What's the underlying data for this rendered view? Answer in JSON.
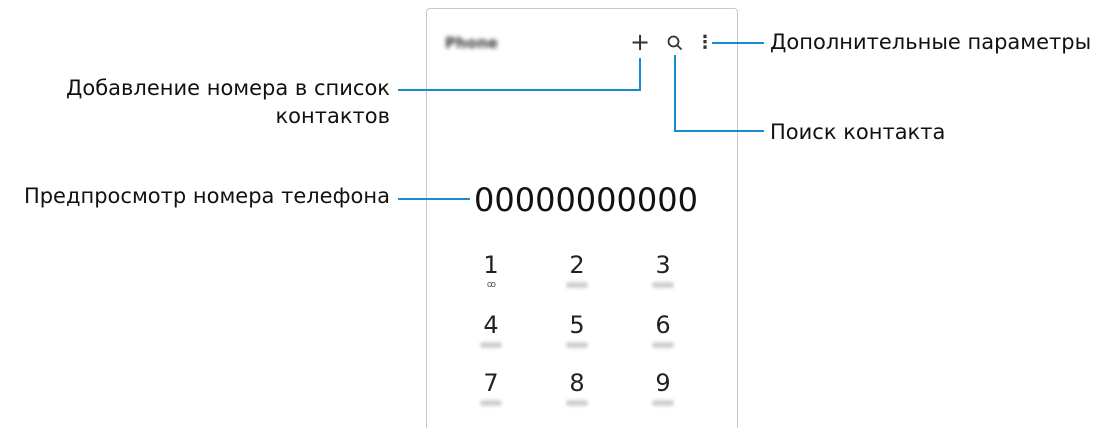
{
  "app": {
    "title": "Phone"
  },
  "toolbar": {
    "add_icon": "+",
    "more_icon": "⋮"
  },
  "number_preview": "00000000000",
  "keypad": {
    "keys": [
      {
        "digit": "1",
        "sub": "ꝏ"
      },
      {
        "digit": "2"
      },
      {
        "digit": "3"
      },
      {
        "digit": "4"
      },
      {
        "digit": "5"
      },
      {
        "digit": "6"
      },
      {
        "digit": "7"
      },
      {
        "digit": "8"
      },
      {
        "digit": "9"
      }
    ]
  },
  "callouts": {
    "add_contact_line1": "Добавление номера в список",
    "add_contact_line2": "контактов",
    "number_preview": "Предпросмотр номера телефона",
    "more_options": "Дополнительные параметры",
    "search_contact": "Поиск контакта"
  },
  "colors": {
    "leader_line": "#1a8ad4",
    "frame": "#c8c8c8"
  }
}
